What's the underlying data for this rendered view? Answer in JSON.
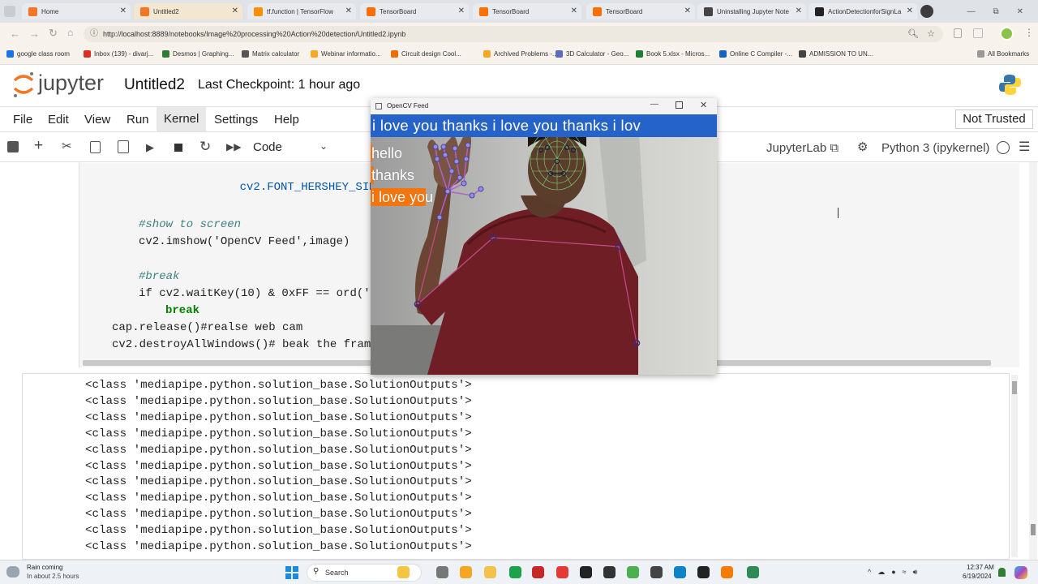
{
  "browser": {
    "tabs": [
      {
        "label": "Home",
        "icon_color": "#f37626"
      },
      {
        "label": "Untitled2",
        "icon_color": "#f37626"
      },
      {
        "label": "tf.function  |  TensorFlow",
        "icon_color": "#ff8f00"
      },
      {
        "label": "TensorBoard",
        "icon_color": "#ff6f00"
      },
      {
        "label": "TensorBoard",
        "icon_color": "#ff6f00"
      },
      {
        "label": "TensorBoard",
        "icon_color": "#ff6f00"
      },
      {
        "label": "Uninstalling Jupyter Note",
        "icon_color": "#444444"
      },
      {
        "label": "ActionDetectionforSignLa",
        "icon_color": "#222222"
      }
    ],
    "new_tab": "+",
    "url": "http://localhost:8889/notebooks/Image%20processing%20Action%20detection/Untitled2.ipynb",
    "bookmarks": [
      {
        "label": "google class room",
        "color": "#1a73e8"
      },
      {
        "label": "Inbox (139) - divarj...",
        "color": "#d93025"
      },
      {
        "label": "Desmos | Graphing...",
        "color": "#2e7d32"
      },
      {
        "label": "Matrix calculator",
        "color": "#555555"
      },
      {
        "label": "Webinar informatio...",
        "color": "#f9a825"
      },
      {
        "label": "Circuit design Cool...",
        "color": "#ef6c00"
      },
      {
        "label": "Archived Problems -...",
        "color": "#f9a825"
      },
      {
        "label": "3D Calculator - Geo...",
        "color": "#5c6bc0"
      },
      {
        "label": "Book 5.xlsx - Micros...",
        "color": "#1e7e34"
      },
      {
        "label": "Online C Compiler -...",
        "color": "#1565c0"
      },
      {
        "label": "ADMISSION TO UN...",
        "color": "#444444"
      }
    ],
    "all_bookmarks": "All Bookmarks"
  },
  "jupyter": {
    "logo_text": "jupyter",
    "notebook_name": "Untitled2",
    "checkpoint": "Last Checkpoint: 1 hour ago",
    "menus": [
      "File",
      "Edit",
      "View",
      "Run",
      "Kernel",
      "Settings",
      "Help"
    ],
    "trust": "Not Trusted",
    "cell_type": "Code",
    "jupyterlab_link": "JupyterLab",
    "kernel_name": "Python 3 (ipykernel)"
  },
  "code_lines": [
    {
      "text": "cv2.FONT_HERSHEY_SIMPLEX"
    },
    {
      "text": "#show to screen"
    },
    {
      "text": "cv2.imshow('OpenCV Feed',image)"
    },
    {
      "text": "#break"
    },
    {
      "text": "if cv2.waitKey(10) & 0xFF == ord('q"
    },
    {
      "text": "break"
    },
    {
      "text": "cap.release()#realse web cam"
    },
    {
      "text": "cv2.destroyAllWindows()# beak the frame"
    }
  ],
  "output_line": "<class 'mediapipe.python.solution_base.SolutionOutputs'>",
  "output_count": 11,
  "opencv": {
    "title": "OpenCV Feed",
    "sentence": "i love you thanks i love you thanks i lov",
    "labels": [
      "hello",
      "thanks",
      "i love you"
    ],
    "label_probabilities": [
      0.02,
      0.04,
      0.62
    ]
  },
  "taskbar": {
    "weather_title": "Rain coming",
    "weather_sub": "In about 2.5 hours",
    "search": "Search",
    "time": "12:37 AM",
    "date": "6/19/2024"
  },
  "colors": {
    "jupyter_orange": "#f37626",
    "banner_blue": "#2563c9",
    "prob_bar": "#f5750d",
    "code_keyword": "#008000",
    "code_comment": "#408080"
  }
}
